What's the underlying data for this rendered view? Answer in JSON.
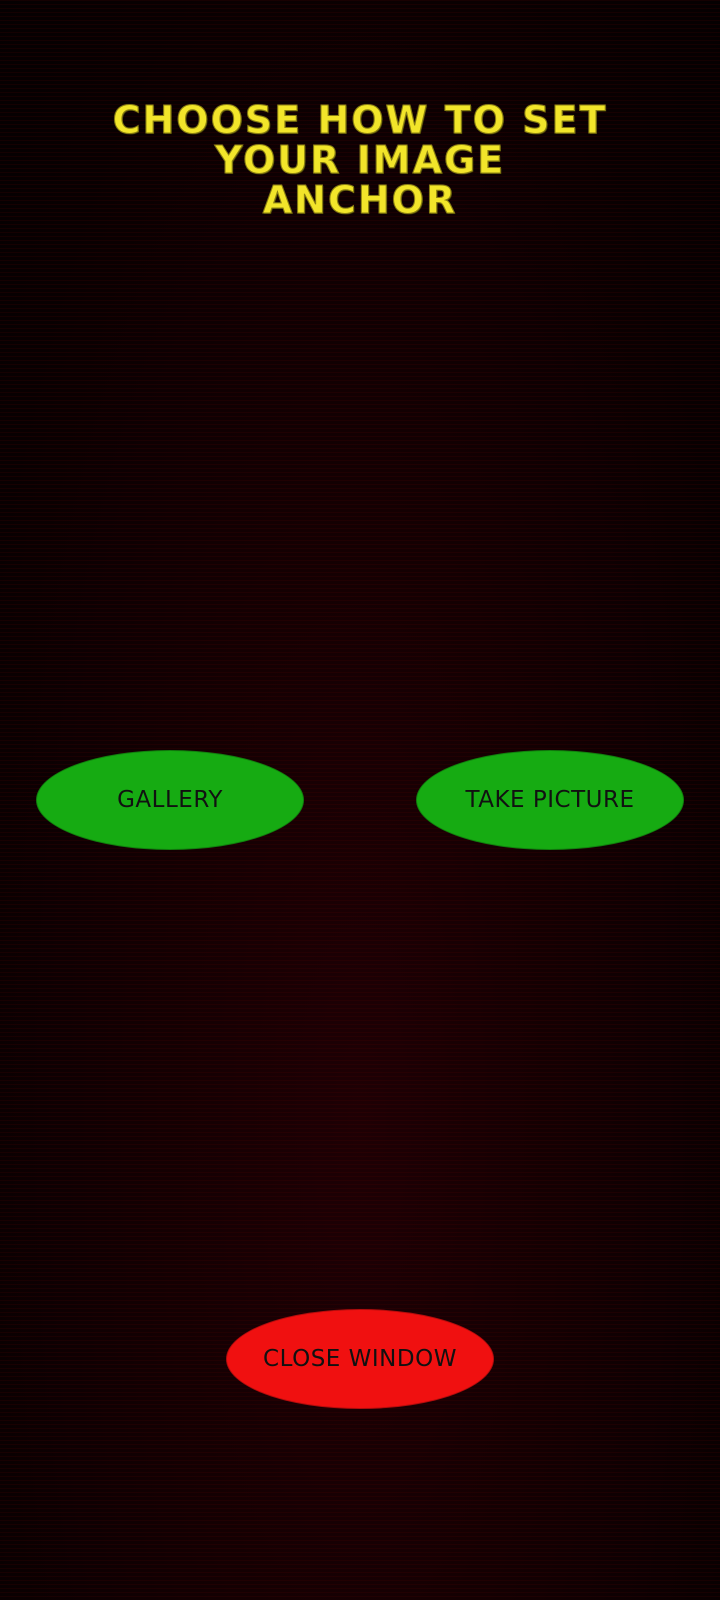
{
  "title": "CHOOSE HOW TO SET YOUR IMAGE ANCHOR",
  "buttons": {
    "gallery": "GALLERY",
    "take_picture": "TAKE PICTURE",
    "close_window": "CLOSE WINDOW"
  },
  "colors": {
    "title": "#f2e52a",
    "action_button": "#16ab12",
    "close_button": "#f01010",
    "background": "#120002"
  }
}
